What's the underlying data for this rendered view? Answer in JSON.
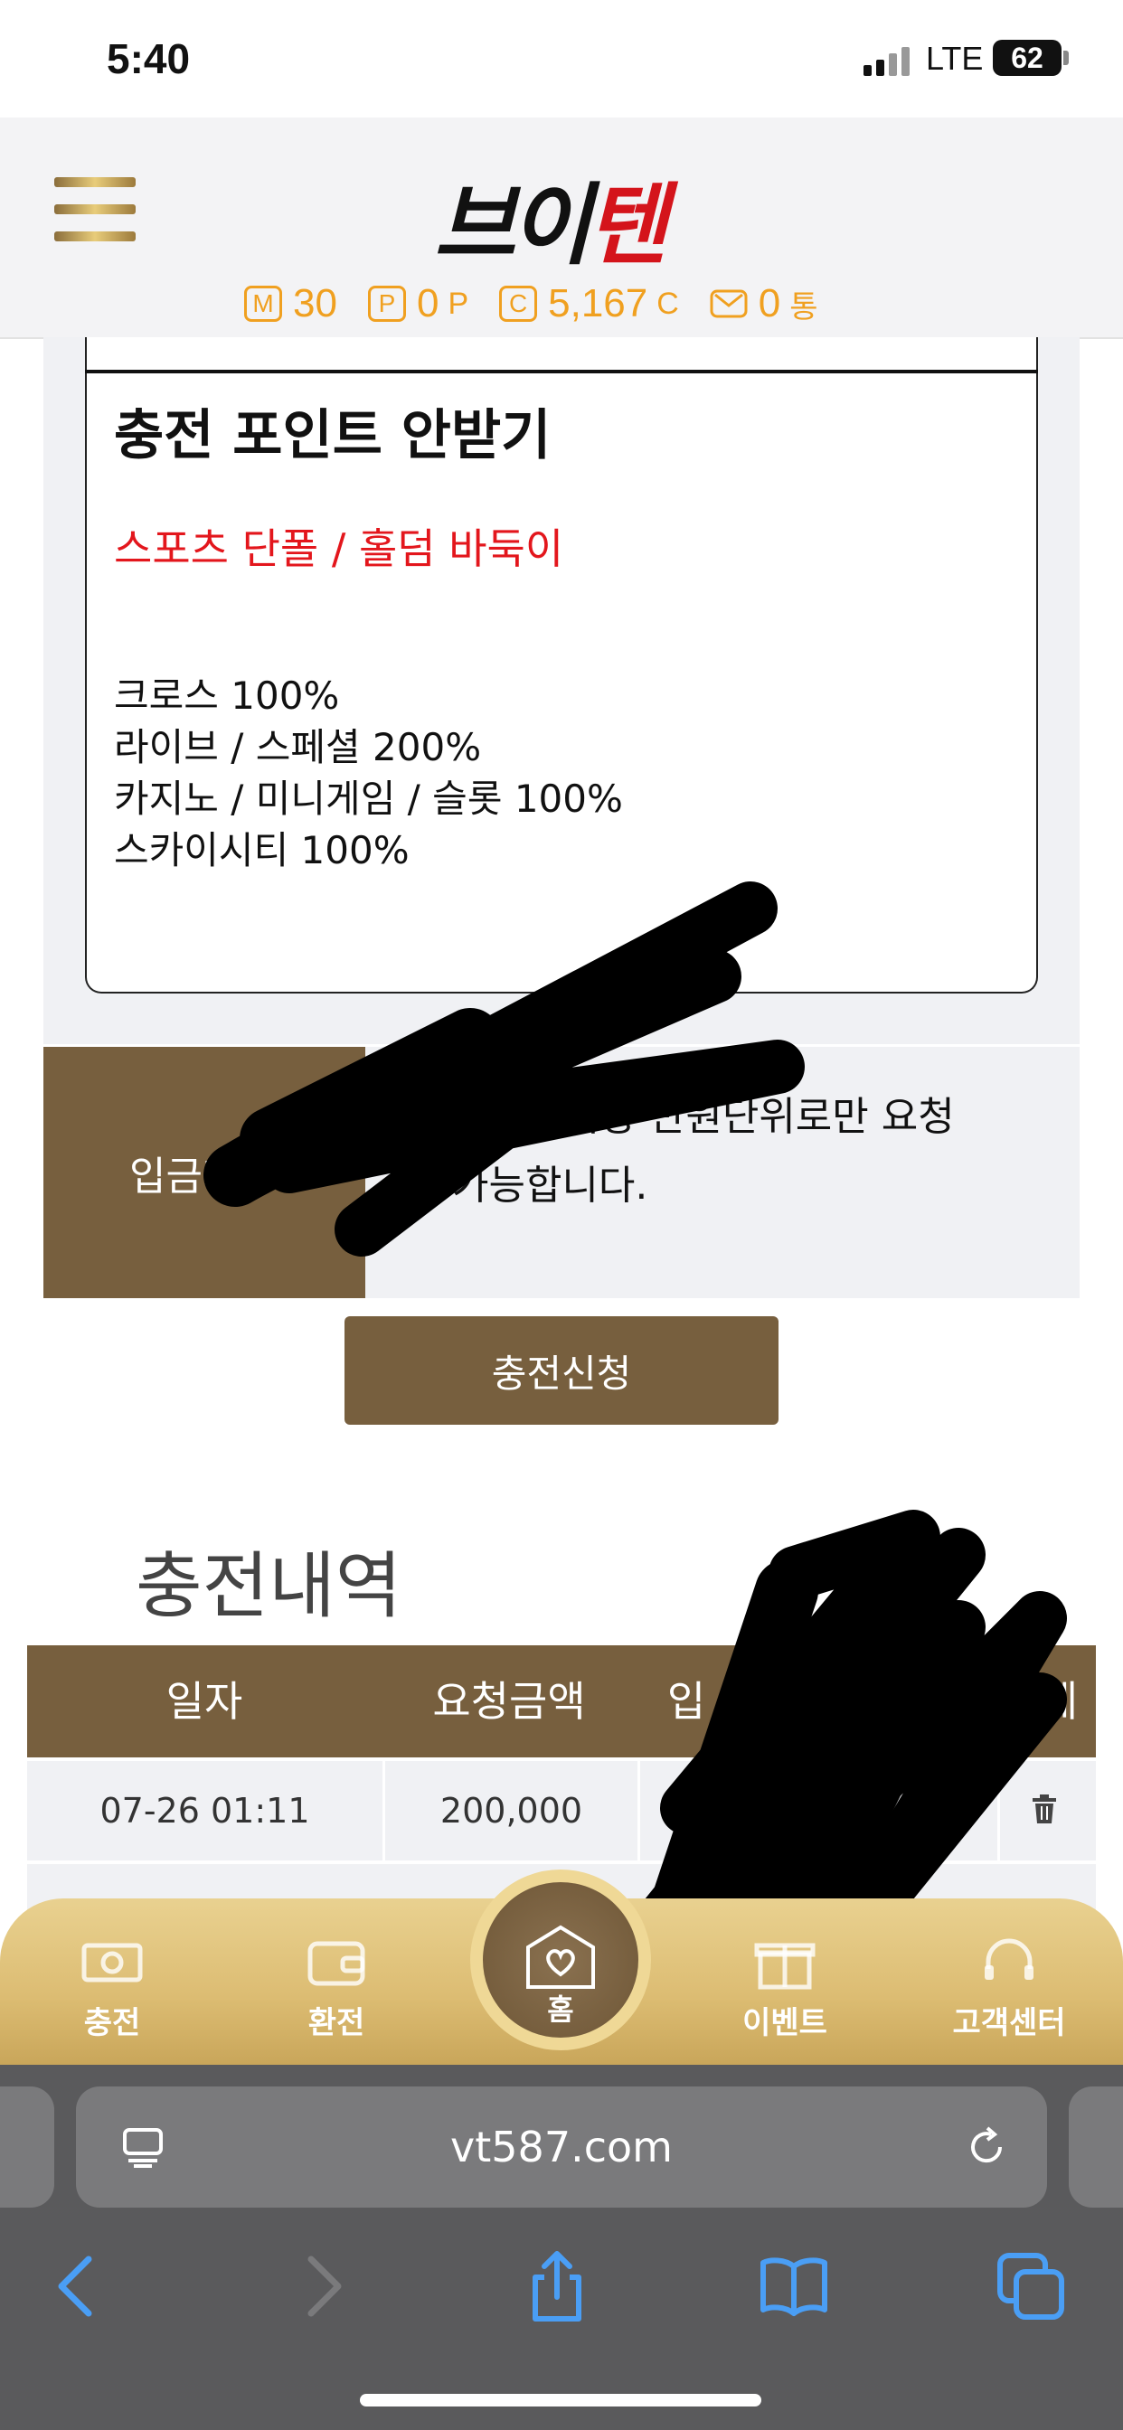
{
  "status_bar": {
    "time": "5:40",
    "network": "LTE",
    "battery": "62"
  },
  "header": {
    "logo_part1": "브이",
    "logo_part2": "텐",
    "stats": [
      {
        "icon": "M",
        "value": "30",
        "unit": ""
      },
      {
        "icon": "P",
        "value": "0",
        "unit": "P"
      },
      {
        "icon": "C",
        "value": "5,167",
        "unit": "C"
      },
      {
        "icon": "mail",
        "value": "0",
        "unit": "통"
      }
    ]
  },
  "notice": {
    "title": "충전 포인트 안받기",
    "red_text": "스포츠 단폴 / 홀덤 바둑이",
    "lines": [
      "크로스 100%",
      "라이브 / 스페셜 200%",
      "카지노 / 미니게임 / 슬롯 100%",
      "스카이시티 100%"
    ]
  },
  "deposit": {
    "label": "입금지",
    "text_line1": "1만원 이상 만원단위로만 요청",
    "text_line2": "가능합니다."
  },
  "apply_button": "충전신청",
  "history": {
    "title": "충전내역",
    "columns": [
      "일자",
      "요청금액",
      "입",
      "제"
    ],
    "rows": [
      {
        "date": "07-26 01:11",
        "amount": "200,000"
      }
    ]
  },
  "tabbar": {
    "charge": "충전",
    "exchange": "환전",
    "home": "홈",
    "event": "이벤트",
    "support": "고객센터"
  },
  "browser": {
    "url": "vt587.com"
  },
  "colors": {
    "brown": "#775f3e",
    "gold": "#e9d190",
    "orange": "#f0a020",
    "red": "#e3161c"
  }
}
